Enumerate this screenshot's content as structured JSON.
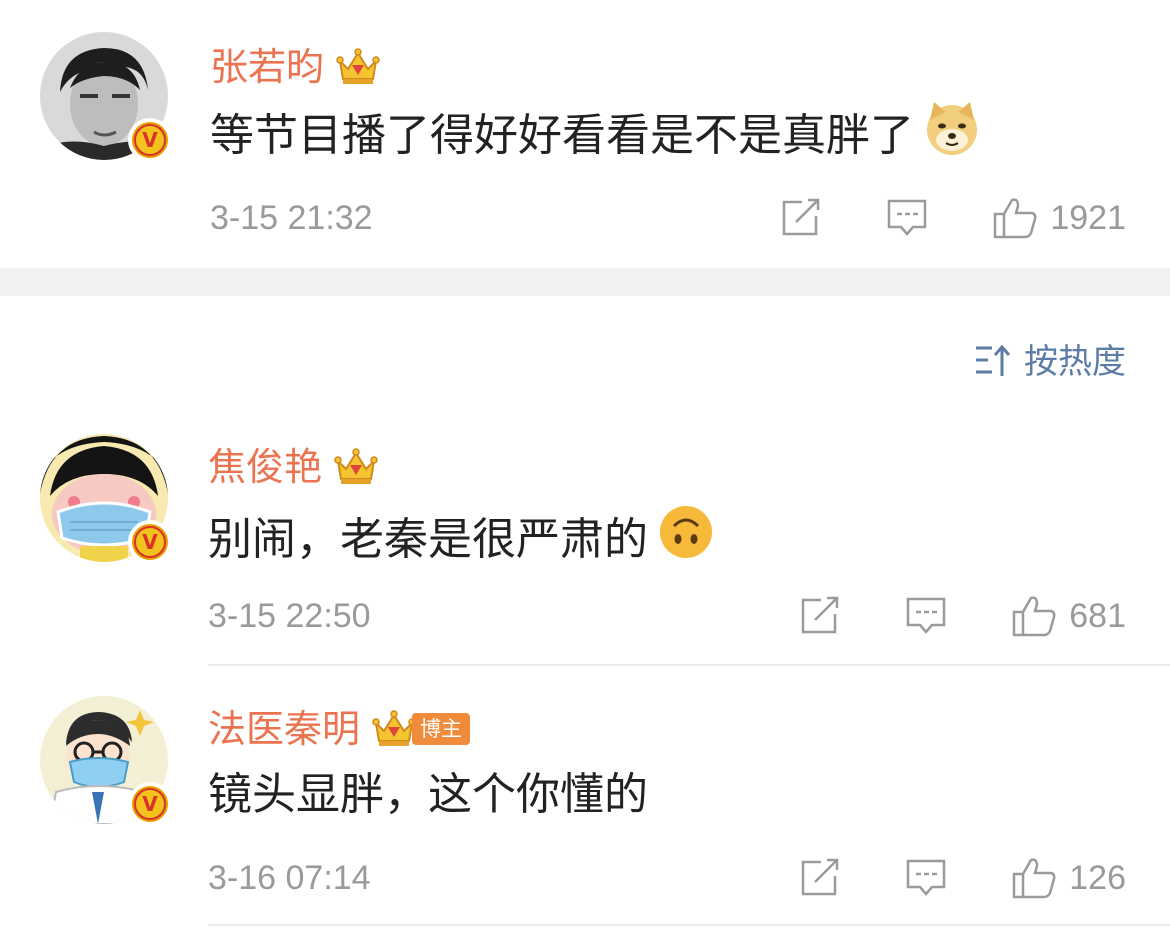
{
  "colors": {
    "name": "#eb7350",
    "text": "#222222",
    "meta": "#9a9a9a",
    "sort": "#5d7da6",
    "badge_tag": "#f18b3c",
    "separator": "#f2f2f2"
  },
  "top_comment": {
    "author": "张若昀",
    "text": "等节目播了得好好看看是不是真胖了",
    "emoji": "doge-emoji",
    "time": "3-15 21:32",
    "likes": "1921",
    "avatar_badge": "V"
  },
  "sort": {
    "label": "按热度",
    "icon": "sort-icon"
  },
  "replies": [
    {
      "author": "焦俊艳",
      "text": "别闹，老秦是很严肃的",
      "emoji": "upside-down-face-emoji",
      "time": "3-15 22:50",
      "likes": "681",
      "avatar_badge": "V"
    },
    {
      "author": "法医秦明",
      "tag": "博主",
      "text": "镜头显胖，这个你懂的",
      "time": "3-16 07:14",
      "likes": "126",
      "avatar_badge": "V"
    }
  ],
  "icons": {
    "share": "share-icon",
    "comment": "comment-icon",
    "like": "like-icon",
    "crown": "crown-icon",
    "verified": "verified-icon"
  }
}
